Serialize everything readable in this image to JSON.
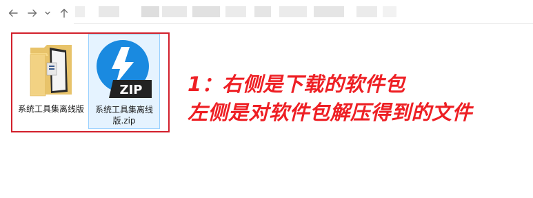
{
  "navigation": {
    "back_icon": "arrow-left",
    "forward_icon": "arrow-right",
    "recent_icon": "chevron-down",
    "up_icon": "arrow-up",
    "icon_color": "#6e6e6e"
  },
  "address_bar": {
    "value": "",
    "obscured": true
  },
  "files": [
    {
      "label": "系统工具集离线版",
      "icon": "folder-icon",
      "selected": false
    },
    {
      "label": "系统工具集离线版.zip",
      "icon": "zip-archive-icon",
      "badge_text": "ZIP",
      "selected": true
    }
  ],
  "annotation": {
    "line1": "1：右侧是下载的软件包",
    "line2": "左侧是对软件包解压得到的文件",
    "color": "#ee1f24"
  },
  "colors": {
    "highlight_frame": "#d21f2b",
    "selection_fill": "#e5f3ff",
    "selection_border": "#99d1ff",
    "zip_circle": "#1a8ae0",
    "zip_badge": "#222222"
  }
}
